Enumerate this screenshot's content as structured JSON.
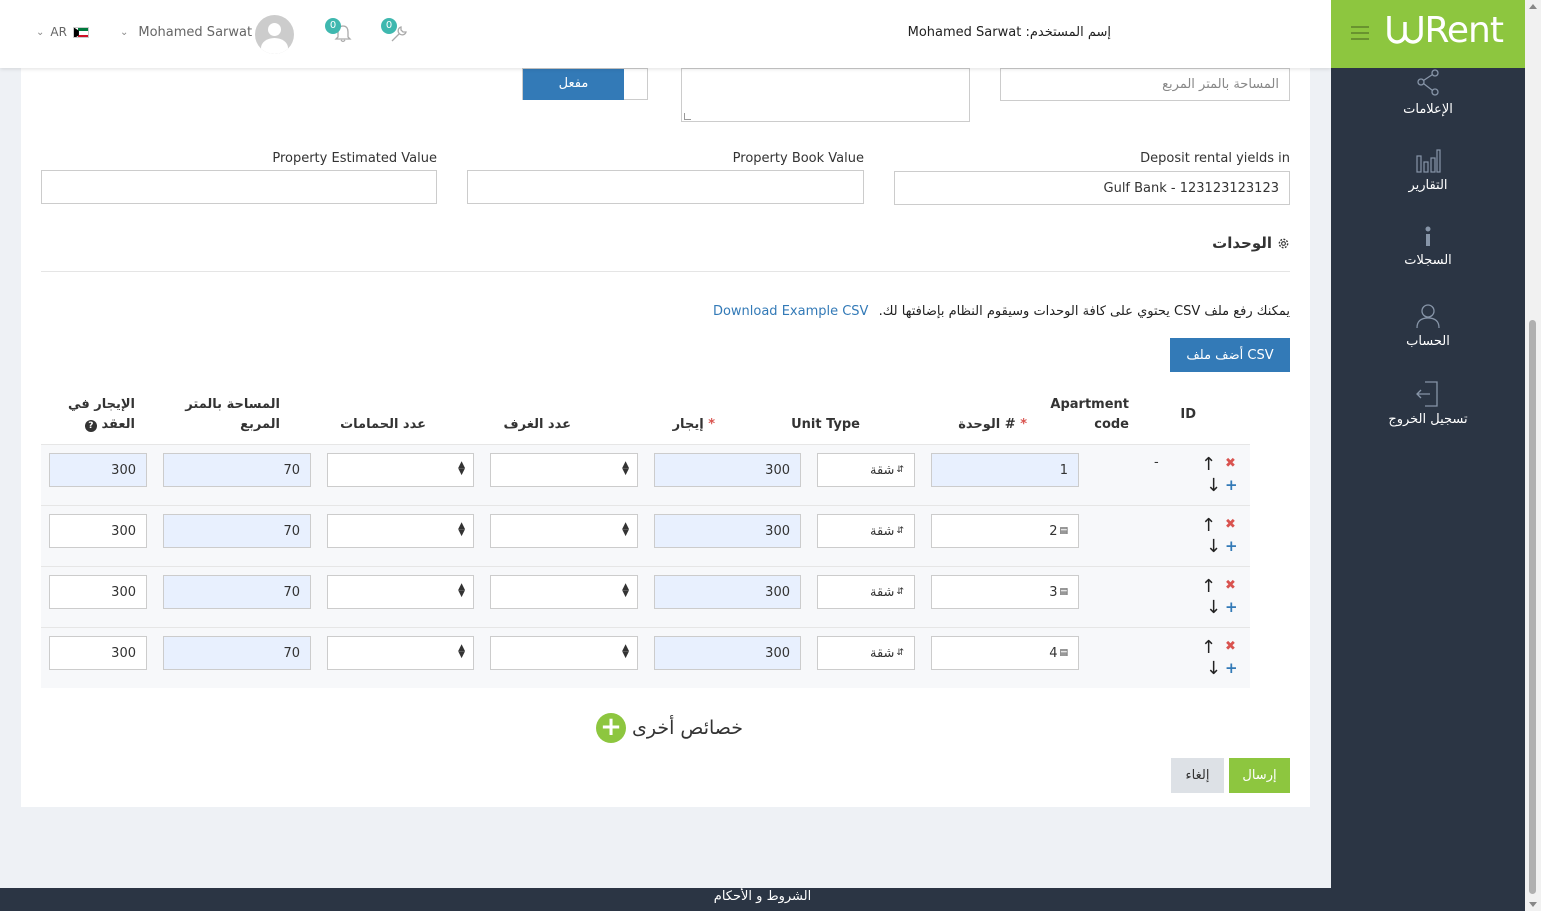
{
  "header": {
    "user_label": "إسم المستخدم:",
    "user_value": "Mohamed Sarwat",
    "profile_name": "Mohamed Sarwat",
    "lang": "AR",
    "tools_count": "0",
    "bell_count": "0",
    "logo": "Rent"
  },
  "sidebar": {
    "items": [
      {
        "label": "الإعلامات",
        "icon": "share-icon"
      },
      {
        "label": "التقارير",
        "icon": "bar-chart-icon"
      },
      {
        "label": "السجلات",
        "icon": "info-icon"
      },
      {
        "label": "الحساب",
        "icon": "user-icon"
      },
      {
        "label": "تسجيل الخروج",
        "icon": "logout-icon"
      }
    ]
  },
  "form": {
    "area_placeholder": "المساحة بالمتر المربع",
    "toggle_label": "مفعل",
    "deposit_label": "Deposit rental yields in",
    "deposit_value": "Gulf Bank - 123123123123",
    "book_value_label": "Property Book Value",
    "estimated_value_label": "Property Estimated Value"
  },
  "units": {
    "title": "الوحدات",
    "csv_text": "يمكنك رفع ملف CSV يحتوي على كافة الوحدات وسيقوم النظام بإضافتها لك.",
    "csv_link": "Download Example CSV",
    "csv_button": "أضف ملف CSV",
    "headers": {
      "id": "ID",
      "apartment_code_1": "Apartment",
      "apartment_code_2": "code",
      "unit_no": "الوحدة #",
      "unit_type": "Unit Type",
      "rent": "إيجار",
      "rooms": "عدد الغرف",
      "baths": "عدد الحمامات",
      "area_1": "المساحة بالمتر",
      "area_2": "المربع",
      "contract_rent_1": "الإيجار في",
      "contract_rent_2": "العقد"
    },
    "rows": [
      {
        "id": "-",
        "unit": "1",
        "type": "شقة",
        "rent": "300",
        "area": "70",
        "contract_rent": "300"
      },
      {
        "id": "",
        "unit": "2",
        "type": "شقة",
        "rent": "300",
        "area": "70",
        "contract_rent": "300"
      },
      {
        "id": "",
        "unit": "3",
        "type": "شقة",
        "rent": "300",
        "area": "70",
        "contract_rent": "300"
      },
      {
        "id": "",
        "unit": "4",
        "type": "شقة",
        "rent": "300",
        "area": "70",
        "contract_rent": "300"
      }
    ]
  },
  "more_features": "خصائص أخرى",
  "actions": {
    "send": "إرسال",
    "cancel": "إلغاء"
  },
  "footer": "الشروط و الأحكام",
  "colors": {
    "brand_green": "#8dc63f",
    "primary_blue": "#337ab7",
    "sidebar_dark": "#2b3544"
  }
}
